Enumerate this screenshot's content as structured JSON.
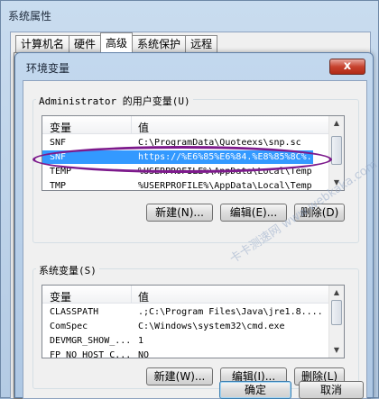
{
  "outer_window": {
    "title": "系统属性",
    "tabs": [
      "计算机名",
      "硬件",
      "高级",
      "系统保护",
      "远程"
    ],
    "active_tab": "高级"
  },
  "dialog": {
    "title": "环境变量",
    "close_glyph": "x",
    "user_group_label": "Administrator 的用户变量(U)",
    "system_group_label": "系统变量(S)",
    "col_variable": "变量",
    "col_value": "值",
    "user_vars": [
      {
        "name": "SNF",
        "value": "C:\\ProgramData\\Quoteexs\\snp.sc"
      },
      {
        "name": "SNF",
        "value": "https://%E6%85%E6%84.%E8%85%8C%..."
      },
      {
        "name": "TEMP",
        "value": "%USERPROFILE%\\AppData\\Local\\Temp"
      },
      {
        "name": "TMP",
        "value": "%USERPROFILE%\\AppData\\Local\\Temp"
      }
    ],
    "user_selected_index": 1,
    "system_vars": [
      {
        "name": "CLASSPATH",
        "value": ".;C:\\Program Files\\Java\\jre1.8...."
      },
      {
        "name": "ComSpec",
        "value": "C:\\Windows\\system32\\cmd.exe"
      },
      {
        "name": "DEVMGR_SHOW_...",
        "value": "1"
      },
      {
        "name": "FP_NO_HOST_C...",
        "value": "NO"
      }
    ],
    "user_buttons": {
      "new": "新建(N)...",
      "edit": "编辑(E)...",
      "delete": "删除(D)"
    },
    "system_buttons": {
      "new": "新建(W)...",
      "edit": "编辑(I)...",
      "delete": "删除(L)"
    },
    "ok": "确定",
    "cancel": "取消"
  },
  "watermark": "卡卡测速网 www.webkaka.com",
  "colors": {
    "selection": "#3399ff",
    "highlight_ellipse": "#7d1a8c",
    "close_button": "#c7432f"
  }
}
